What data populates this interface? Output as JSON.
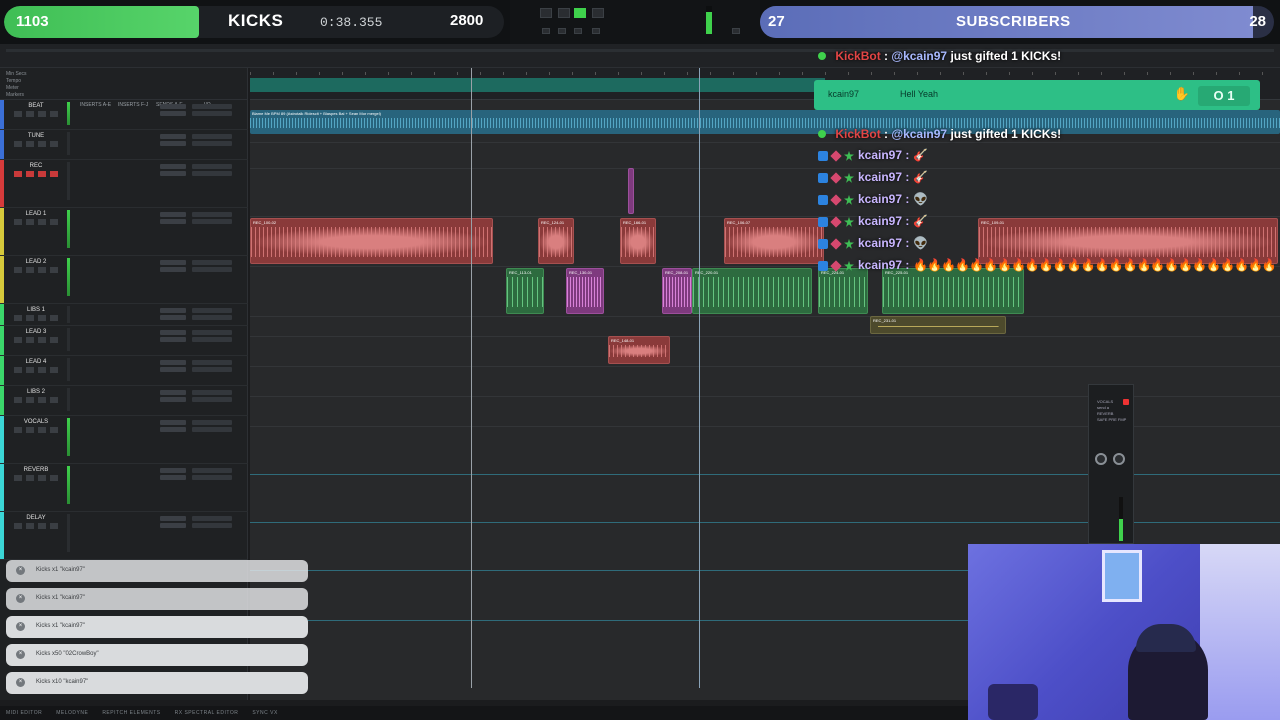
{
  "overlay": {
    "kicks_bar": {
      "count": "1103",
      "title": "KICKS",
      "time": "0:38.355",
      "goal": "2800",
      "progress": 0.39
    },
    "subs_bar": {
      "count": "27",
      "title": "SUBSCRIBERS",
      "goal": "28",
      "progress": 0.96
    }
  },
  "alerts": {
    "gift_top": {
      "bot": "KickBot",
      "text_user": "@kcain97",
      "text": "just gifted 1 KICKs!"
    },
    "gift_second": {
      "bot": "KickBot",
      "text_user": "@kcain97",
      "text": "just gifted 1 KICKs!"
    },
    "hype": {
      "user": "kcain97",
      "message": "Hell Yeah",
      "count": "01",
      "count_display": "O 1"
    }
  },
  "chat": [
    {
      "user": "kcain97 :",
      "emote": "🎸"
    },
    {
      "user": "kcain97 :",
      "emote": "🎸"
    },
    {
      "user": "kcain97 :",
      "emote": "👽"
    },
    {
      "user": "kcain97 :",
      "emote": "🎸"
    },
    {
      "user": "kcain97 :",
      "emote": "👽"
    },
    {
      "user": "kcain97 :",
      "emote": "🔥🔥🔥🔥🔥🔥🔥🔥🔥🔥🔥🔥🔥🔥🔥🔥🔥🔥🔥🔥🔥🔥🔥🔥🔥🔥"
    }
  ],
  "tracks": [
    {
      "name": "BEAT",
      "color": "#3b6fd6"
    },
    {
      "name": "TUNE",
      "color": "#3b6fd6"
    },
    {
      "name": "REC",
      "color": "#d63b3b"
    },
    {
      "name": "LEAD 1",
      "color": "#d6c93b"
    },
    {
      "name": "LEAD 2",
      "color": "#d6c93b"
    },
    {
      "name": "LIBS 1",
      "color": "#3bd66a"
    },
    {
      "name": "LEAD 3",
      "color": "#3bd66a"
    },
    {
      "name": "LEAD 4",
      "color": "#3bd66a"
    },
    {
      "name": "LIBS 2",
      "color": "#3bd66a"
    },
    {
      "name": "VOCALS",
      "color": "#3bd6d6"
    },
    {
      "name": "REVERB",
      "color": "#3bd6d6"
    },
    {
      "name": "DELAY",
      "color": "#3bd6d6"
    }
  ],
  "track_list_header": {
    "rows": [
      "Min Secs",
      "Tempo",
      "Meter",
      "Markers"
    ],
    "columns": [
      "INSERTS A-E",
      "INSERTS F-J",
      "SENDS A-E",
      "I/O"
    ]
  },
  "clips": {
    "beat": "Blame Me BPM 89 (Astrotalk Ridesclt + Blaspes Bal + Sean Mor mergel)",
    "rec1": "REC_100-02",
    "rec2": "REC_124-01",
    "rec3": "REC_166-01",
    "rec4": "REC_106-07",
    "rec5": "REC_109-01",
    "g1": "REC_113-01",
    "p1": "REC_130-01",
    "g2": "REC_208-01",
    "g3": "REC_220-01",
    "g4": "REC_224-01",
    "g5": "REC_225-01",
    "olive": "REC_231-01",
    "lead3": "REC_148-01"
  },
  "kick_list": [
    "Kicks x1 \"kcain97\"",
    "Kicks x1 \"kcain97\"",
    "Kicks x1 \"kcain97\"",
    "Kicks x50 \"02CrowBoy\"",
    "Kicks x10 \"kcain97\""
  ],
  "mini_mixer": {
    "title": "VOCALS",
    "lines": [
      "send a",
      "REVERB",
      "SAFE  PRE  FMP"
    ]
  },
  "bottom_bar": [
    "MIDI EDITOR",
    "MELODYNE",
    "REPITCH ELEMENTS",
    "RX SPECTRAL EDITOR",
    "SYNC VX"
  ],
  "colors": {
    "kick_green": "#3fbe55",
    "sub_purple": "#7f8bd0",
    "hype_teal": "#2dbf86",
    "bot_red": "#e34545"
  }
}
